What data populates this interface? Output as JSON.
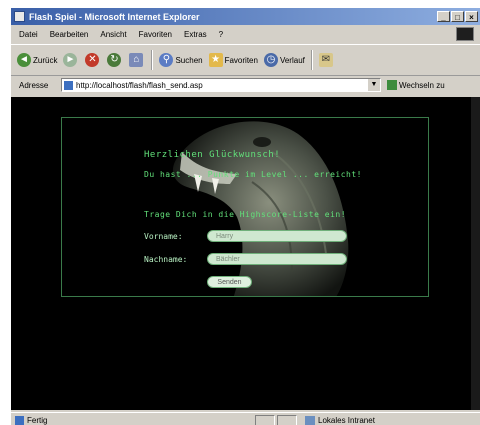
{
  "window": {
    "title": "Flash Spiel - Microsoft Internet Explorer",
    "controls": {
      "minimize": "_",
      "maximize": "□",
      "close": "×"
    }
  },
  "menubar": {
    "items": [
      "Datei",
      "Bearbeiten",
      "Ansicht",
      "Favoriten",
      "Extras",
      "?"
    ]
  },
  "toolbar": {
    "back": "Zurück",
    "search": "Suchen",
    "favorites": "Favoriten",
    "history": "Verlauf"
  },
  "address": {
    "label": "Adresse",
    "url": "http://localhost/flash/flash_send.asp",
    "go": "Wechseln zu"
  },
  "flash": {
    "congrats": "Herzlichen Glückwunsch!",
    "level_line": "Du hast ... Punkte im Level ... erreicht!",
    "highscore_prompt": "Trage Dich in die Highscore-Liste ein!",
    "firstname_label": "Vorname:",
    "firstname_value": "Harry",
    "lastname_label": "Nachname:",
    "lastname_value": "Bächler",
    "send_button": "Senden"
  },
  "statusbar": {
    "status": "Fertig",
    "zone": "Lokales Intranet"
  }
}
